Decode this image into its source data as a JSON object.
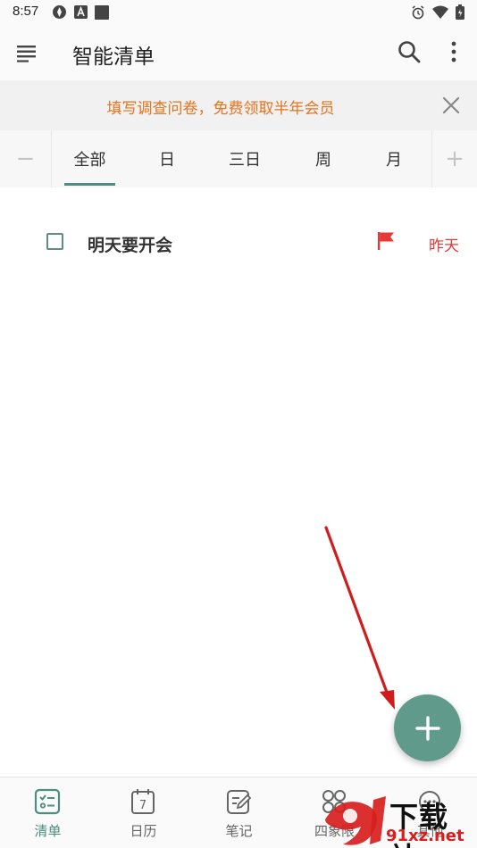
{
  "status_bar": {
    "time": "8:57"
  },
  "app_bar": {
    "title": "智能清单"
  },
  "banner": {
    "text": "填写调查问卷，免费领取半年会员"
  },
  "tabs": {
    "minus": "−",
    "plus": "+",
    "items": [
      {
        "label": "全部",
        "active": true
      },
      {
        "label": "日",
        "active": false
      },
      {
        "label": "三日",
        "active": false
      },
      {
        "label": "周",
        "active": false
      },
      {
        "label": "月",
        "active": false
      }
    ]
  },
  "tasks": [
    {
      "title": "明天要开会",
      "due": "昨天",
      "flag_color": "#e53935",
      "done": false
    }
  ],
  "bottom_nav": {
    "items": [
      {
        "label": "清单",
        "icon": "checklist-icon",
        "active": true
      },
      {
        "label": "日历",
        "icon": "calendar-icon",
        "calendar_day": "7",
        "active": false
      },
      {
        "label": "笔记",
        "icon": "note-icon",
        "active": false
      },
      {
        "label": "四象限",
        "icon": "quadrant-icon",
        "active": false
      },
      {
        "label": "其他",
        "icon": "other-icon",
        "active": false
      }
    ]
  },
  "watermark": {
    "brand": "下载站",
    "domain": "91xz.net"
  },
  "colors": {
    "accent": "#4a8f7f",
    "fab": "#5f9a8a",
    "banner_text": "#e8731d",
    "due_red": "#e53935"
  }
}
